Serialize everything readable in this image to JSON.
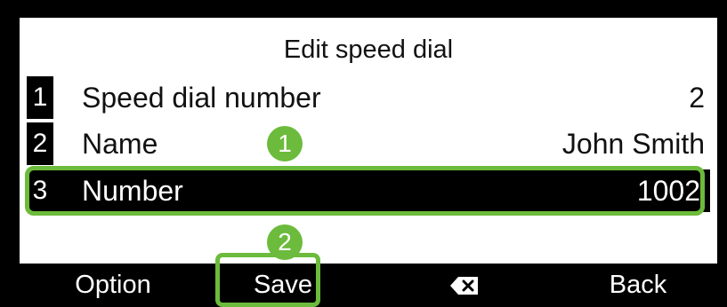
{
  "screen": {
    "title": "Edit speed dial"
  },
  "rows": [
    {
      "index": "1",
      "label": "Speed dial number",
      "value": "2"
    },
    {
      "index": "2",
      "label": "Name",
      "value": "John Smith"
    },
    {
      "index": "3",
      "label": "Number",
      "value": "1002"
    }
  ],
  "markers": {
    "first": "1",
    "second": "2"
  },
  "softkeys": {
    "option": "Option",
    "save": "Save",
    "backspace_icon": "backspace-icon",
    "back": "Back"
  },
  "colors": {
    "accent": "#6cbb3c",
    "background": "#ffffff",
    "bar": "#000000"
  }
}
